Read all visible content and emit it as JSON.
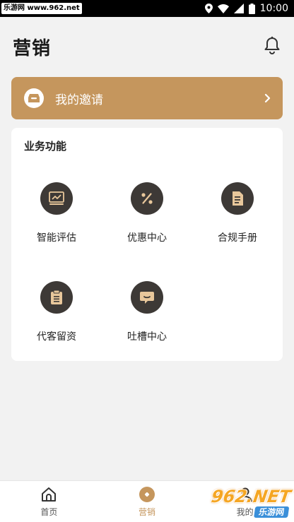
{
  "status_bar": {
    "watermark_text": "乐游网 www.962.net",
    "time": "10:00"
  },
  "header": {
    "title": "营销",
    "bell_icon": "bell-icon"
  },
  "invite": {
    "label": "我的邀请",
    "icon": "inbox-icon"
  },
  "functions": {
    "title": "业务功能",
    "items": [
      {
        "label": "智能评估",
        "icon": "chart-icon"
      },
      {
        "label": "优惠中心",
        "icon": "percent-icon"
      },
      {
        "label": "合规手册",
        "icon": "document-icon"
      },
      {
        "label": "代客留资",
        "icon": "clipboard-icon"
      },
      {
        "label": "吐槽中心",
        "icon": "chat-icon"
      }
    ]
  },
  "bottom_nav": {
    "items": [
      {
        "label": "首页",
        "icon": "home-icon",
        "active": false
      },
      {
        "label": "营销",
        "icon": "marketing-icon",
        "active": true
      },
      {
        "label": "我的",
        "icon": "profile-icon",
        "active": false
      }
    ]
  },
  "colors": {
    "accent": "#c5965d",
    "icon_bg": "#3d3936",
    "background": "#f2f2f2"
  },
  "watermark": {
    "brand": "962.NET",
    "sub": "乐游网"
  }
}
